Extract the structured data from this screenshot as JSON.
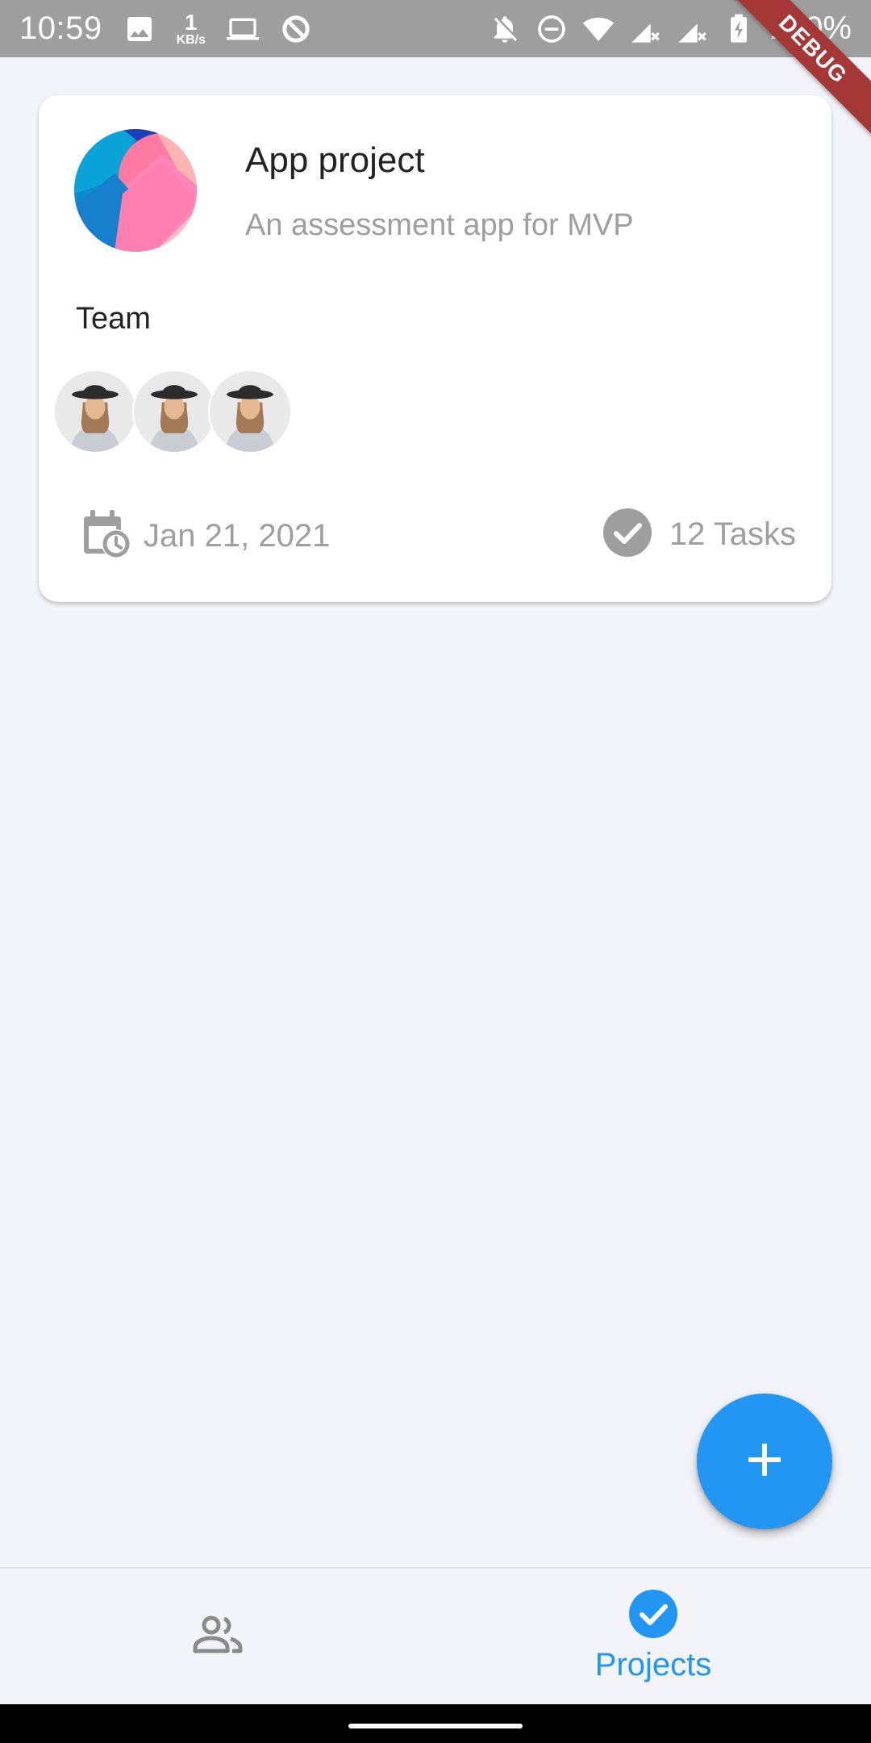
{
  "status_bar": {
    "time": "10:59",
    "net_speed_value": "1",
    "net_speed_unit": "KB/s",
    "battery": "100%",
    "icons": [
      "image-icon",
      "laptop-icon",
      "sync-icon",
      "notifications-off-icon",
      "do-not-disturb-icon",
      "wifi-icon",
      "signal-icon",
      "signal-icon",
      "battery-charging-icon"
    ]
  },
  "debug_banner": "DEBUG",
  "project": {
    "name": "App project",
    "description": "An assessment app for MVP",
    "team_label": "Team",
    "members": [
      "member-1",
      "member-2",
      "member-3"
    ],
    "due_date": "Jan 21, 2021",
    "tasks": "12 Tasks"
  },
  "fab": {
    "icon": "plus-icon"
  },
  "bottom_nav": {
    "items": [
      {
        "icon": "people-icon",
        "label": ""
      },
      {
        "icon": "check-circle-icon",
        "label": "Projects",
        "active": true
      }
    ]
  },
  "colors": {
    "accent": "#2196f3",
    "background": "#f3f4f9",
    "status_bar": "#9e9e9e",
    "debug": "#a53737"
  }
}
